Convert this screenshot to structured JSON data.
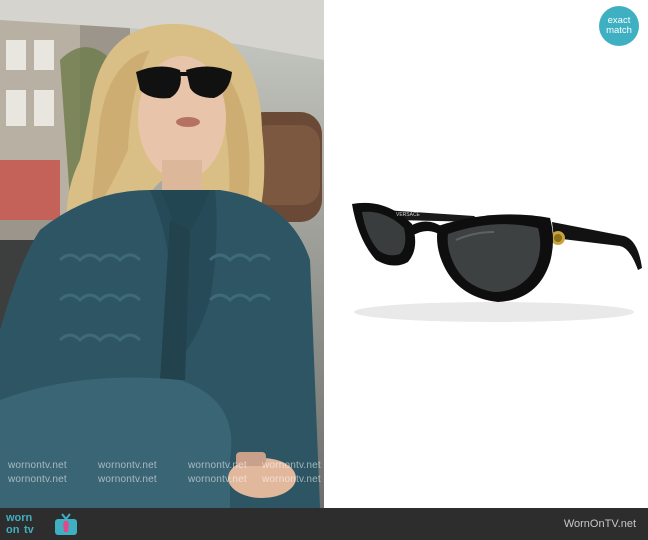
{
  "badge": {
    "line1": "exact",
    "line2": "match",
    "color": "#3eb0c2"
  },
  "watermark": "wornontv.net",
  "footer": {
    "logo_word1": "worn",
    "logo_word2": "on",
    "logo_word3": "tv",
    "logo_color": "#3eb0c2",
    "logo_accent": "#e04a8a",
    "site_url": "WornOnTV.net"
  },
  "product": {
    "temple_text": "VERSACE"
  },
  "icons": [
    "tv-icon"
  ]
}
